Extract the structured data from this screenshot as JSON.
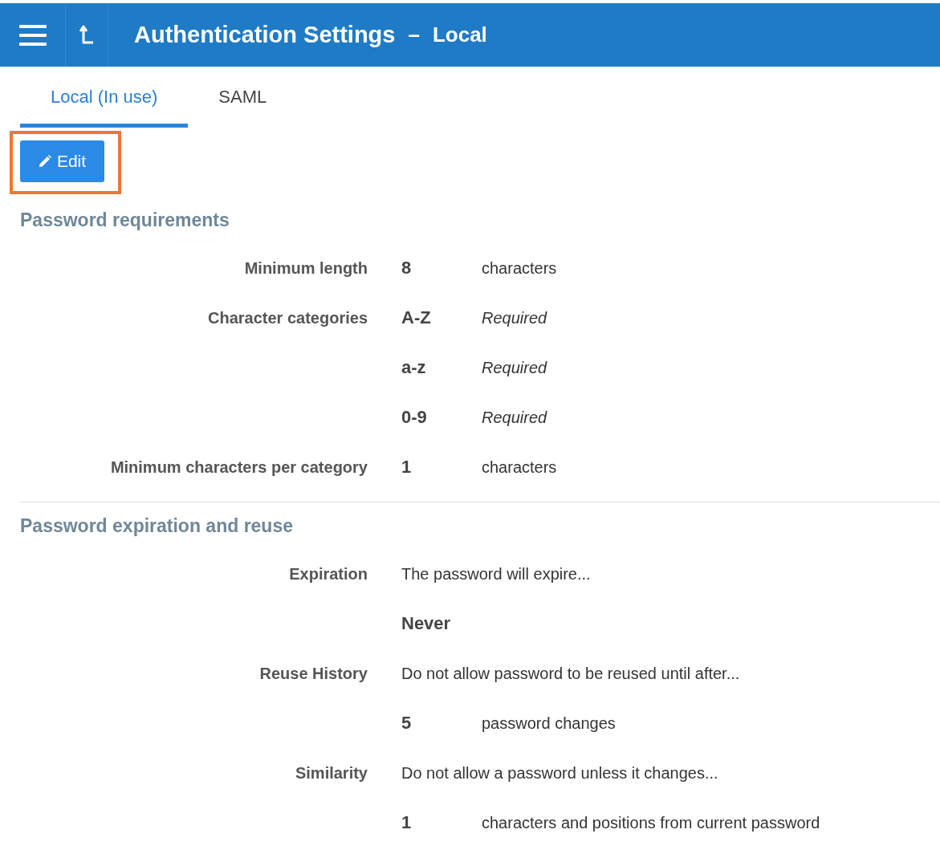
{
  "header": {
    "title": "Authentication Settings",
    "separator": "–",
    "subtitle": "Local"
  },
  "tabs": [
    {
      "label": "Local (In use)",
      "selected": true
    },
    {
      "label": "SAML",
      "selected": false
    }
  ],
  "edit_button": {
    "label": "Edit",
    "highlighted": true
  },
  "sections": [
    {
      "title": "Password requirements",
      "rows": [
        {
          "kind": "amount",
          "label": "Minimum length",
          "value": "8",
          "note": "characters"
        },
        {
          "kind": "requirement",
          "label": "Character categories",
          "value": "A-Z",
          "note": "Required"
        },
        {
          "kind": "requirement",
          "value": "a-z",
          "note": "Required"
        },
        {
          "kind": "requirement",
          "value": "0-9",
          "note": "Required"
        },
        {
          "kind": "amount",
          "label": "Minimum characters per category",
          "value": "1",
          "note": "characters"
        }
      ]
    },
    {
      "title": "Password expiration and reuse",
      "rows": [
        {
          "kind": "sentence",
          "label": "Expiration",
          "text": "The password will expire..."
        },
        {
          "kind": "emphasis",
          "text": "Never"
        },
        {
          "kind": "sentence",
          "label": "Reuse History",
          "text": "Do not allow password to be reused until after..."
        },
        {
          "kind": "amount",
          "value": "5",
          "note": "password changes"
        },
        {
          "kind": "sentence",
          "label": "Similarity",
          "text": "Do not allow a password unless it changes..."
        },
        {
          "kind": "amount",
          "value": "1",
          "note": "characters and positions from current password"
        }
      ]
    }
  ]
}
